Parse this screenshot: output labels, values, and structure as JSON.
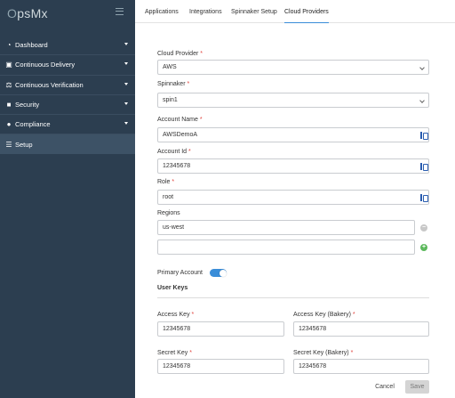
{
  "brand": {
    "logo_prefix": "O",
    "logo_rest": "psMx"
  },
  "sidebar": {
    "items": [
      {
        "label": "Dashboard",
        "icon": "gauge-icon",
        "glyph": "◔",
        "has_chevron": true
      },
      {
        "label": "Continuous Delivery",
        "icon": "truck-icon",
        "glyph": "▣",
        "has_chevron": true
      },
      {
        "label": "Continuous Verification",
        "icon": "verification-icon",
        "glyph": "⚖",
        "has_chevron": true
      },
      {
        "label": "Security",
        "icon": "lock-icon",
        "glyph": "■",
        "has_chevron": true
      },
      {
        "label": "Compliance",
        "icon": "compliance-icon",
        "glyph": "●",
        "has_chevron": true
      },
      {
        "label": "Setup",
        "icon": "sliders-icon",
        "glyph": "☰",
        "has_chevron": false,
        "active": true
      }
    ]
  },
  "tabs": [
    {
      "label": "Applications"
    },
    {
      "label": "Integrations"
    },
    {
      "label": "Spinnaker Setup"
    },
    {
      "label": "Cloud Providers",
      "active": true
    }
  ],
  "form": {
    "cloud_provider": {
      "label": "Cloud Provider",
      "value": "AWS"
    },
    "spinnaker": {
      "label": "Spinnaker",
      "value": "spin1"
    },
    "account_name": {
      "label": "Account Name",
      "value": "AWSDemoA"
    },
    "account_id": {
      "label": "Account Id",
      "value": "12345678"
    },
    "role": {
      "label": "Role",
      "value": "root"
    },
    "regions": {
      "label": "Regions",
      "values": [
        "us-west",
        ""
      ]
    },
    "primary_account": {
      "label": "Primary Account",
      "enabled": true
    },
    "user_keys": {
      "title": "User Keys",
      "access_key": {
        "label": "Access Key",
        "value": "12345678"
      },
      "access_key_bakery": {
        "label": "Access Key (Bakery)",
        "value": "12345678"
      },
      "secret_key": {
        "label": "Secret Key",
        "value": "12345678"
      },
      "secret_key_bakery": {
        "label": "Secret Key (Bakery)",
        "value": "12345678"
      }
    },
    "required_mark": "*"
  },
  "actions": {
    "cancel_label": "Cancel",
    "save_label": "Save"
  },
  "colors": {
    "sidebar_bg": "#2c3e50",
    "sidebar_active": "#3d5266",
    "accent": "#3a8dd8",
    "required": "#e0443e",
    "add": "#5cb85c"
  }
}
